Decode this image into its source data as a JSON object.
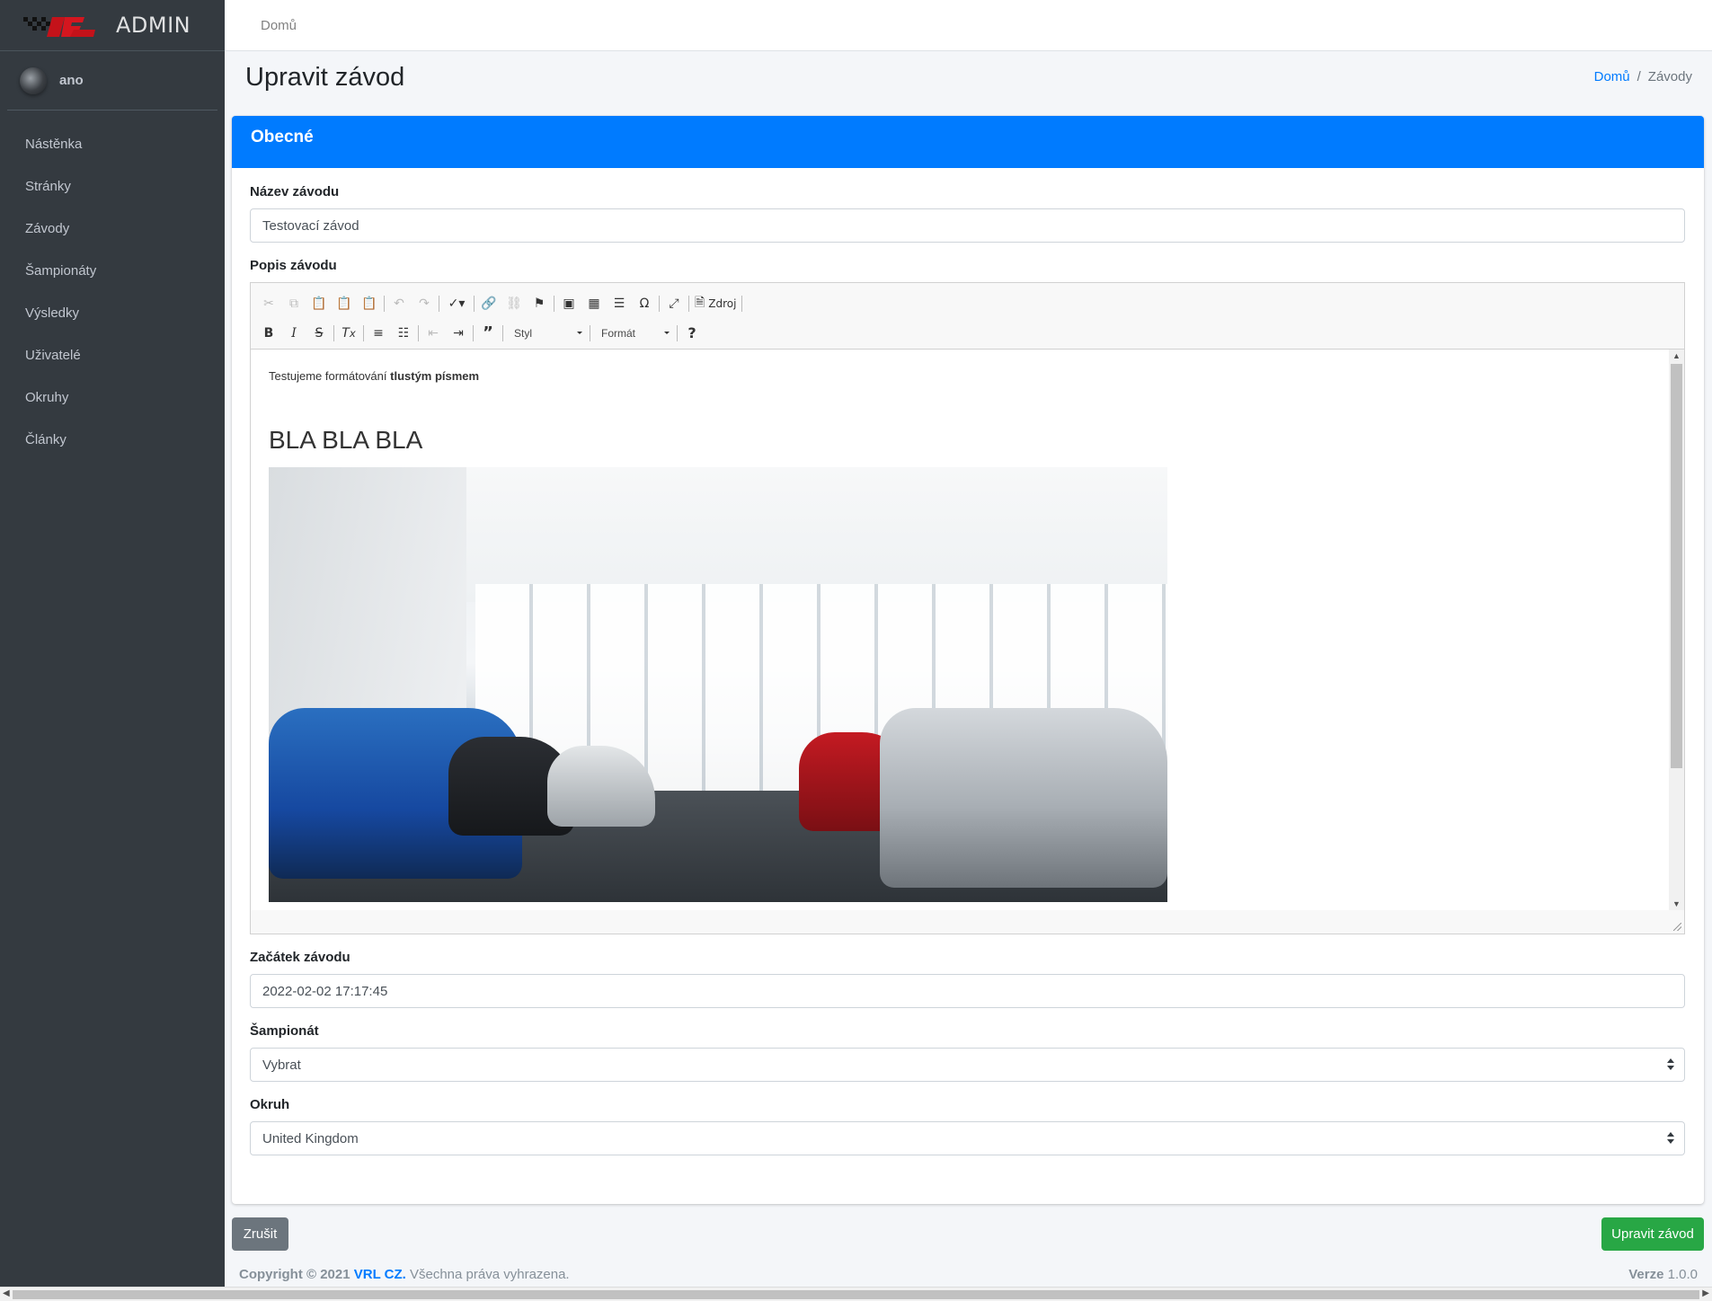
{
  "brand": {
    "text": "ADMIN"
  },
  "user": {
    "name": "ano"
  },
  "sidebar": {
    "items": [
      {
        "label": "Nástěnka"
      },
      {
        "label": "Stránky"
      },
      {
        "label": "Závody"
      },
      {
        "label": "Šampionáty"
      },
      {
        "label": "Výsledky"
      },
      {
        "label": "Uživatelé"
      },
      {
        "label": "Okruhy"
      },
      {
        "label": "Články"
      }
    ]
  },
  "topbar": {
    "home_link": "Domů"
  },
  "page": {
    "title": "Upravit závod",
    "breadcrumb": {
      "home": "Domů",
      "separator": "/",
      "current": "Závody"
    }
  },
  "card": {
    "title": "Obecné",
    "header_color": "#007bff",
    "fields": {
      "name": {
        "label": "Název závodu",
        "value": "Testovací závod"
      },
      "description": {
        "label": "Popis závodu",
        "toolbar": {
          "style_combo": "Styl",
          "format_combo": "Formát",
          "source_label": "Zdroj",
          "help": "?"
        },
        "content": {
          "paragraph_text": "Testujeme formátování ",
          "paragraph_bold": "tlustým písmem",
          "heading": "BLA BLA BLA"
        }
      },
      "start": {
        "label": "Začátek závodu",
        "value": "2022-02-02 17:17:45"
      },
      "championship": {
        "label": "Šampionát",
        "selected": "Vybrat"
      },
      "circuit": {
        "label": "Okruh",
        "selected": "United Kingdom"
      }
    }
  },
  "buttons": {
    "cancel": "Zrušit",
    "save": "Upravit závod",
    "cancel_color": "#6c757d",
    "save_color": "#28a745"
  },
  "footer": {
    "copyright": "Copyright © 2021",
    "company": "VRL CZ.",
    "rights": " Všechna práva vyhrazena.",
    "version_label": "Verze",
    "version": "1.0.0"
  }
}
